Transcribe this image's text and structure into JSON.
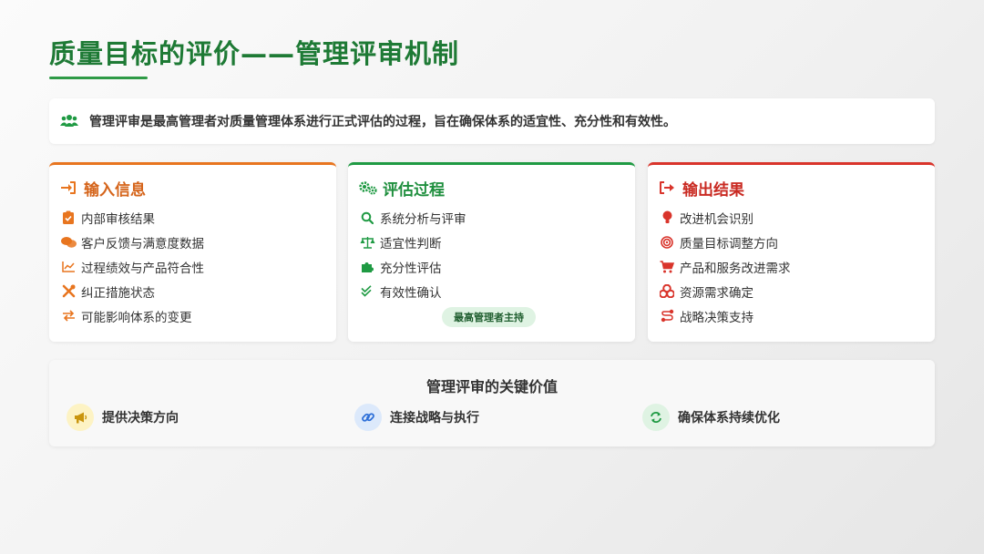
{
  "page": {
    "title": "质量目标的评价——管理评审机制",
    "intro": "管理评审是最高管理者对质量管理体系进行正式评估的过程，旨在确保体系的适宜性、充分性和有效性。"
  },
  "colors": {
    "green": "#1f9a43",
    "orange": "#e8751f",
    "red": "#d9342b",
    "title_green": "#1e7a35"
  },
  "cards": {
    "input": {
      "title": "输入信息",
      "icon": "sign-in-icon",
      "items": [
        {
          "label": "内部审核结果",
          "icon": "clipboard-check-icon"
        },
        {
          "label": "客户反馈与满意度数据",
          "icon": "comments-icon"
        },
        {
          "label": "过程绩效与产品符合性",
          "icon": "chart-line-icon"
        },
        {
          "label": "纠正措施状态",
          "icon": "tools-icon"
        },
        {
          "label": "可能影响体系的变更",
          "icon": "exchange-icon"
        }
      ]
    },
    "process": {
      "title": "评估过程",
      "icon": "cogs-icon",
      "items": [
        {
          "label": "系统分析与评审",
          "icon": "search-icon"
        },
        {
          "label": "适宜性判断",
          "icon": "balance-scale-icon"
        },
        {
          "label": "充分性评估",
          "icon": "puzzle-piece-icon"
        },
        {
          "label": "有效性确认",
          "icon": "double-check-icon"
        }
      ],
      "badge": "最高管理者主持"
    },
    "output": {
      "title": "输出结果",
      "icon": "sign-out-icon",
      "items": [
        {
          "label": "改进机会识别",
          "icon": "lightbulb-icon"
        },
        {
          "label": "质量目标调整方向",
          "icon": "bullseye-icon"
        },
        {
          "label": "产品和服务改进需求",
          "icon": "cart-icon"
        },
        {
          "label": "资源需求确定",
          "icon": "cubes-icon"
        },
        {
          "label": "战略决策支持",
          "icon": "route-icon"
        }
      ]
    }
  },
  "values": {
    "title": "管理评审的关键价值",
    "items": [
      {
        "label": "提供决策方向",
        "icon": "bullhorn-icon",
        "bg": "#fdf3c4",
        "fg": "#c9950e"
      },
      {
        "label": "连接战略与执行",
        "icon": "link-icon",
        "bg": "#dce9fb",
        "fg": "#2d6fd8"
      },
      {
        "label": "确保体系持续优化",
        "icon": "sync-icon",
        "bg": "#dff3e3",
        "fg": "#1f9a43"
      }
    ]
  }
}
